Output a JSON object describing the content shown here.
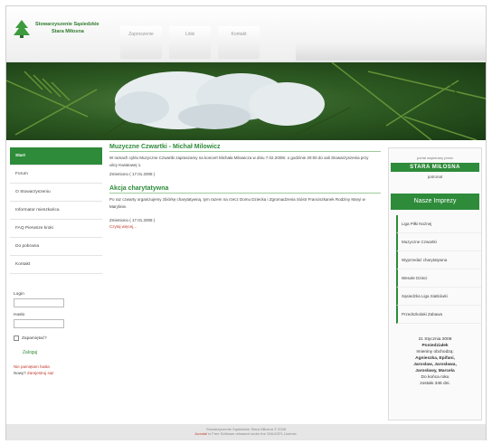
{
  "brand": {
    "line1": "Stowarzyszenie Sąsiedzkie",
    "line2": "Stara Miłosna"
  },
  "topnav": [
    "Zaproszenie",
    "Linki",
    "Kontakt"
  ],
  "sidebar": {
    "items": [
      {
        "label": "Start",
        "active": true
      },
      {
        "label": "Forum",
        "active": false
      },
      {
        "label": "O Stowarzyszeniu",
        "active": false
      },
      {
        "label": "Informator mieszkańca",
        "active": false
      },
      {
        "label": "FAQ Pierwsze kroki",
        "active": false
      },
      {
        "label": "Do pobrania",
        "active": false
      },
      {
        "label": "Kontakt",
        "active": false
      }
    ]
  },
  "login": {
    "login_label": "Login",
    "password_label": "Hasło",
    "remember_label": "Zapamiętać?",
    "submit_label": "Zaloguj",
    "forgot": "Nie pamiętam hasła",
    "no_account": "Nowy?",
    "register": "Zarejestruj się!"
  },
  "articles": [
    {
      "title": "Muzyczne Czwartki - Michał Milowicz",
      "body": "W ramach cyklu Muzyczne Czwartki zapraszamy na koncert Michała Milowicza w dniu 7.02.2008r. o godzinie 20:00 do sali Stowarzyszenia przy ulicy Kwiatowej 1.",
      "meta": "Zmieniono ( 17.01.2008 )",
      "link": ""
    },
    {
      "title": "Akcja charytatywna",
      "body": "Po raz czwarty organizujemy zbiórkę charytatywną, tym razem na rzecz Domu Dziecka i Zgromadzenia Sióstr Franciszkanek Rodziny Maryi w Marylinie.",
      "meta": "Zmieniono ( 17.01.2008 )",
      "link": "Czytaj więcej..."
    }
  ],
  "sponsor": {
    "small": "portal wspierany przez",
    "name": "STARA MIŁOSNA",
    "after": "patronat"
  },
  "events": {
    "title": "Nasze Imprezy",
    "items": [
      "Liga Piłki Nożnej",
      "Muzyczne Czwartki",
      "Wyprzedaż charytatywna",
      "Wesołe Dzieci",
      "Sąsiedzka Liga Siatkówki",
      "Przedszkolaki Zabawa"
    ]
  },
  "nameday": {
    "date": "21 Stycznia 2008",
    "day": "Poniedziałek",
    "label": "Imieniny obchodzą:",
    "names1": "Agnieszka, Epifani,",
    "names2": "Jarosław, Jarosława,",
    "names3": "Jarosławy, Marcela",
    "end_label": "Do końca roku",
    "remaining": "zostało 346 dni."
  },
  "footer": {
    "line1": "Stowarzyszenie Sąsiedzkie Stara Miłosna © 2008",
    "line2_prefix": "Joomla!",
    "line2": " is Free Software released under the GNU/GPL License."
  },
  "colors": {
    "accent": "#2e8b3a",
    "link_red": "#c0392b"
  }
}
